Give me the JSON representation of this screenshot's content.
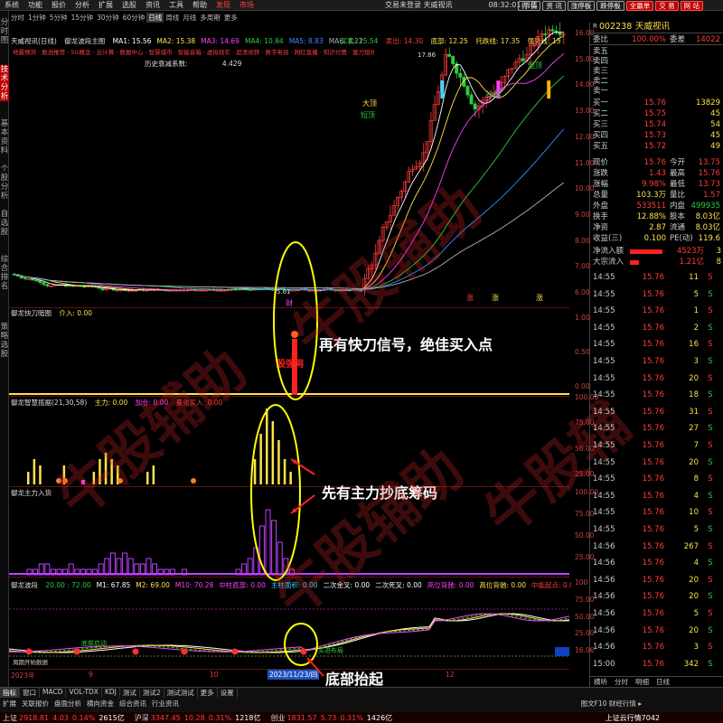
{
  "menu": {
    "items": [
      "系统",
      "功能",
      "报价",
      "分析",
      "扩展",
      "选股",
      "资讯",
      "工具",
      "帮助"
    ],
    "highlight": [
      "发现",
      "市场"
    ],
    "center": "交易未登录 天威视讯",
    "clock": "08:32:01 周二",
    "buttons": [
      "行 情",
      "资 讯",
      "涨停板",
      "跌停板",
      "全赢单",
      "交 易",
      "网 站"
    ]
  },
  "toolbar": {
    "periods": [
      "分时",
      "1分钟",
      "5分钟",
      "15分钟",
      "30分钟",
      "60分钟",
      "日线",
      "周线",
      "月线",
      "多周期",
      "更多"
    ],
    "active": "日线"
  },
  "sidebar": {
    "tabs": [
      "分时图",
      "技术分析",
      "基本资料",
      "个股分析",
      "自选股",
      "综合排名",
      "策略选股"
    ],
    "active": "技术分析"
  },
  "main_chart": {
    "title": "天威视讯(日线)",
    "indicator": "御龙波段主图",
    "ma": [
      "MA1: 15.56",
      "MA2: 15.38",
      "MA3: 14.69",
      "MA4: 10.84",
      "MA5: 8.83",
      "MA6: 8.22"
    ],
    "ma_colors": [
      "#ffffff",
      "#ffe14a",
      "#ff40ff",
      "#2ecc40",
      "#3c8cff",
      "#b0b0b0"
    ],
    "sell": "卖出: 14.30",
    "buy": "买卖: 15.54",
    "support": "底部: 12.25",
    "tracking": "托跌线: 17.35",
    "strong": "强势线: 15",
    "history": "历史衰减系数:",
    "history_val": "4.429",
    "signals": "地震预测 · 股池推荐 · 5G概念 · 云计算 · 数据中心 · 智慧城市 · 智能音箱 · 虚拟现实 · 超清视频 · 数字电视 · 网红直播 · 知识付费 · 富力短线 · 短期持续",
    "high_label": "17.86",
    "low_label": "5.61",
    "signal_labels": [
      "大顶",
      "短顶",
      "抄底",
      "短顶"
    ],
    "buy_markers": [
      "财",
      "涨",
      "涨",
      "涨"
    ],
    "yaxis": [
      "16.00",
      "15.00",
      "14.00",
      "13.00",
      "12.00",
      "11.00",
      "10.00",
      "9.00",
      "8.00",
      "7.00",
      "6.00"
    ]
  },
  "panel2": {
    "title": "御龙快刀暗图",
    "value": "介入: 0.00",
    "yaxis": [
      "1.00",
      "0.50",
      "0.00"
    ],
    "label": "股强网"
  },
  "panel3": {
    "title": "御龙智慧揽据(21,30,58)",
    "values": [
      "主力: 0.00",
      "加仓: 0.00",
      "量化买入: 0.00"
    ],
    "yaxis": [
      "100.00",
      "75.00",
      "50.00",
      "25.00"
    ],
    "bars": [
      2,
      4,
      3,
      0,
      0,
      0,
      3,
      0,
      0,
      0,
      0,
      2,
      4,
      5,
      4,
      3,
      0,
      0,
      0,
      0,
      2,
      3,
      0,
      0,
      0,
      0,
      0,
      0,
      0,
      0,
      0,
      0,
      0,
      0,
      0,
      0,
      0,
      0,
      4,
      8,
      12,
      10,
      7,
      4,
      2,
      0
    ]
  },
  "panel4": {
    "title": "御龙主力入货",
    "yaxis": [
      "100.00",
      "75.00",
      "50.00",
      "25.00"
    ],
    "bars": [
      1,
      1,
      2,
      2,
      1,
      1,
      1,
      2,
      1,
      1,
      1,
      1,
      2,
      3,
      4,
      3,
      4,
      3,
      2,
      2,
      3,
      2,
      1,
      1,
      1,
      0,
      1,
      0,
      0,
      0,
      0,
      0,
      0,
      0,
      0,
      1,
      2,
      3,
      5,
      9,
      12,
      10,
      6,
      3,
      1,
      0
    ]
  },
  "panel5": {
    "title": "御龙波段",
    "values": [
      "20.00 : 72.00",
      "M1: 67.85",
      "M2: 69.00",
      "M10: 70.28",
      "中柱底部: 0.00",
      "主柱面积: 0.00",
      "二次金叉: 0.00",
      "二次死叉: 0.00",
      "高位背驰: 0.00",
      "高位背驰: 0.00",
      "中能起点: 0.00"
    ],
    "value_colors": [
      "#2ecc40",
      "#ffffff",
      "#ffe14a",
      "#ff40ff",
      "#ff40ff",
      "#3cd6ff",
      "#ffffff",
      "#ffffff",
      "#ff40ff",
      "#ffe14a",
      "#ff3c3c"
    ],
    "yaxis": [
      "100",
      "75.00",
      "50.00",
      "25.00",
      "16.06"
    ],
    "labels": [
      "底部启动",
      "买进布局"
    ],
    "bottom_label": "周期开始数据"
  },
  "time_axis": [
    "2023年",
    "9",
    "10",
    "11",
    "12"
  ],
  "cursor_date": "2023/11/23/四",
  "annotations": {
    "a1": "再有快刀信号，绝佳买入点",
    "a2": "先有主力抄底筹码",
    "a3": "底部抬起"
  },
  "watermarks": [
    "牛股辅助",
    "牛股辅助",
    "牛股辅助",
    "牛股辅"
  ],
  "quote": {
    "code": "002238",
    "name": "天威视讯",
    "wb": {
      "label": "委比",
      "pct": "100.00%",
      "label2": "委差",
      "val": "14022"
    },
    "sells": [
      {
        "l": "卖五",
        "p": "",
        "v": ""
      },
      {
        "l": "卖四",
        "p": "",
        "v": ""
      },
      {
        "l": "卖三",
        "p": "",
        "v": ""
      },
      {
        "l": "卖二",
        "p": "",
        "v": ""
      },
      {
        "l": "卖一",
        "p": "",
        "v": ""
      }
    ],
    "buys": [
      {
        "l": "买一",
        "p": "15.76",
        "v": "13829"
      },
      {
        "l": "买二",
        "p": "15.75",
        "v": "45"
      },
      {
        "l": "买三",
        "p": "15.74",
        "v": "54"
      },
      {
        "l": "买四",
        "p": "15.73",
        "v": "45"
      },
      {
        "l": "买五",
        "p": "15.72",
        "v": "49"
      }
    ],
    "stats": [
      {
        "a": "现价",
        "b": "15.76",
        "c": "今开",
        "d": "13.75"
      },
      {
        "a": "涨跌",
        "b": "1.43",
        "c": "最高",
        "d": "15.76"
      },
      {
        "a": "涨幅",
        "b": "9.98%",
        "c": "最低",
        "d": "13.73"
      },
      {
        "a": "总量",
        "b": "103.3万",
        "c": "量比",
        "d": "1.57"
      },
      {
        "a": "外盘",
        "b": "533511",
        "c": "内盘",
        "d": "499935"
      },
      {
        "a": "换手",
        "b": "12.88%",
        "c": "股本",
        "d": "8.03亿"
      },
      {
        "a": "净资",
        "b": "2.87",
        "c": "流通",
        "d": "8.03亿"
      },
      {
        "a": "收益(三)",
        "b": "0.100",
        "c": "PE(动)",
        "d": "119.6"
      }
    ],
    "flows": [
      {
        "l": "净流入额",
        "v": "4523万",
        "x": "3"
      },
      {
        "l": "大宗流入",
        "v": "1.21亿",
        "x": "8"
      }
    ],
    "ticks": [
      {
        "t": "14:55",
        "p": "15.76",
        "v": "11",
        "s": "S"
      },
      {
        "t": "14:55",
        "p": "15.76",
        "v": "5",
        "s": "S"
      },
      {
        "t": "14:55",
        "p": "15.76",
        "v": "1",
        "s": "S"
      },
      {
        "t": "14:55",
        "p": "15.76",
        "v": "2",
        "s": "S"
      },
      {
        "t": "14:55",
        "p": "15.76",
        "v": "16",
        "s": "S"
      },
      {
        "t": "14:55",
        "p": "15.76",
        "v": "3",
        "s": "S"
      },
      {
        "t": "14:55",
        "p": "15.76",
        "v": "20",
        "s": "S"
      },
      {
        "t": "14:55",
        "p": "15.76",
        "v": "18",
        "s": "S"
      },
      {
        "t": "14:55",
        "p": "15.76",
        "v": "31",
        "s": "S"
      },
      {
        "t": "14:55",
        "p": "15.76",
        "v": "27",
        "s": "S"
      },
      {
        "t": "14:55",
        "p": "15.76",
        "v": "7",
        "s": "S"
      },
      {
        "t": "14:55",
        "p": "15.76",
        "v": "20",
        "s": "S"
      },
      {
        "t": "14:55",
        "p": "15.76",
        "v": "8",
        "s": "S"
      },
      {
        "t": "14:55",
        "p": "15.76",
        "v": "4",
        "s": "S"
      },
      {
        "t": "14:55",
        "p": "15.76",
        "v": "10",
        "s": "S"
      },
      {
        "t": "14:55",
        "p": "15.76",
        "v": "5",
        "s": "S"
      },
      {
        "t": "14:56",
        "p": "15.76",
        "v": "267",
        "s": "S"
      },
      {
        "t": "14:56",
        "p": "15.76",
        "v": "4",
        "s": "S"
      },
      {
        "t": "14:56",
        "p": "15.76",
        "v": "20",
        "s": "S"
      },
      {
        "t": "14:56",
        "p": "15.76",
        "v": "20",
        "s": "S"
      },
      {
        "t": "14:56",
        "p": "15.76",
        "v": "5",
        "s": "S"
      },
      {
        "t": "14:56",
        "p": "15.76",
        "v": "20",
        "s": "S"
      },
      {
        "t": "14:56",
        "p": "15.76",
        "v": "3",
        "s": "S"
      },
      {
        "t": "15:00",
        "p": "15.76",
        "v": "342",
        "s": "S"
      }
    ],
    "bottom_tabs": [
      "横听",
      "分时",
      "明细",
      "日线"
    ]
  },
  "bottom": {
    "tabs": [
      "指标",
      "窗口",
      "MACD",
      "VOL-TDX",
      "KDJ",
      "测试",
      "测试2",
      "测试测试",
      "更多",
      "设置"
    ],
    "tabs2": [
      "扩展",
      "关联报价",
      "盘面分析",
      "横向资金",
      "综合资讯",
      "行业资讯"
    ],
    "right": "图文F10 财经行情 ▸",
    "ticker": [
      {
        "k": "上证",
        "v": "2918.81",
        "c": "4.03",
        "pc": "0.14%",
        "vol": "2615亿"
      },
      {
        "k": "沪深",
        "v": "3347.45",
        "c": "10.28",
        "pc": "0.31%",
        "vol": "1218亿"
      },
      {
        "k": "创业",
        "v": "1831.57",
        "c": "5.73",
        "pc": "0.31%",
        "vol": "1426亿"
      }
    ],
    "ticker_right": "上证云行情7042"
  }
}
